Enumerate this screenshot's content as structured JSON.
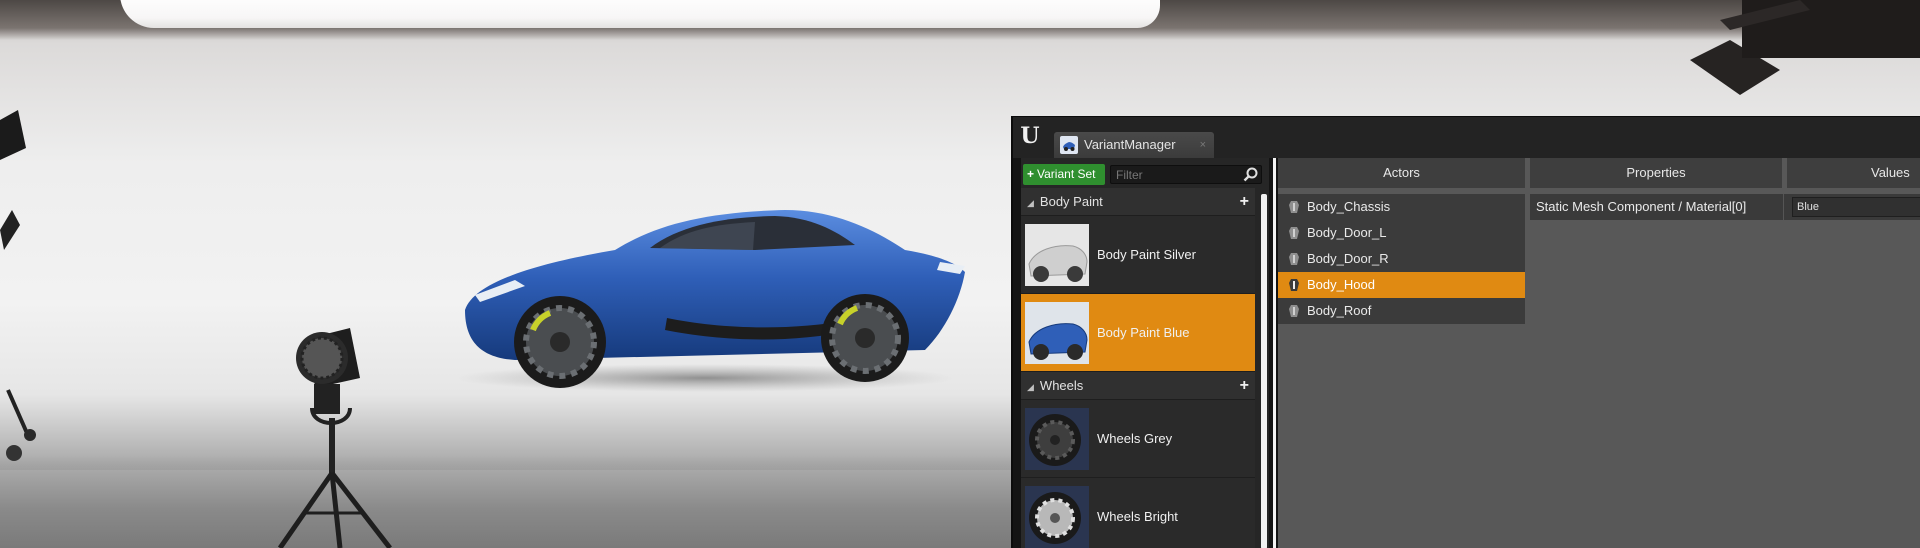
{
  "window": {
    "tab_label": "VariantManager",
    "tab_close": "×"
  },
  "variant_panel": {
    "add_button_label": "Variant Set",
    "filter_placeholder": "Filter",
    "variant_sets": [
      {
        "name": "Body Paint",
        "variants": [
          {
            "label": "Body Paint Silver",
            "selected": false,
            "swatch": "#d8d8d8"
          },
          {
            "label": "Body Paint Blue",
            "selected": true,
            "swatch": "#2f5fb8"
          }
        ]
      },
      {
        "name": "Wheels",
        "variants": [
          {
            "label": "Wheels Grey",
            "selected": false,
            "swatch": "#4a4a4a"
          },
          {
            "label": "Wheels Bright",
            "selected": false,
            "swatch": "#c8c8c8"
          }
        ]
      }
    ]
  },
  "columns": {
    "actors": "Actors",
    "properties": "Properties",
    "values": "Values"
  },
  "actors": [
    {
      "label": "Body_Chassis",
      "selected": false
    },
    {
      "label": "Body_Door_L",
      "selected": false
    },
    {
      "label": "Body_Door_R",
      "selected": false
    },
    {
      "label": "Body_Hood",
      "selected": true
    },
    {
      "label": "Body_Roof",
      "selected": false
    }
  ],
  "property": {
    "name": "Static Mesh Component / Material[0]",
    "value": "Blue"
  },
  "colors": {
    "selection": "#e08a12",
    "add_button": "#2f8f2f",
    "car_paint": "#2f5fb8"
  }
}
